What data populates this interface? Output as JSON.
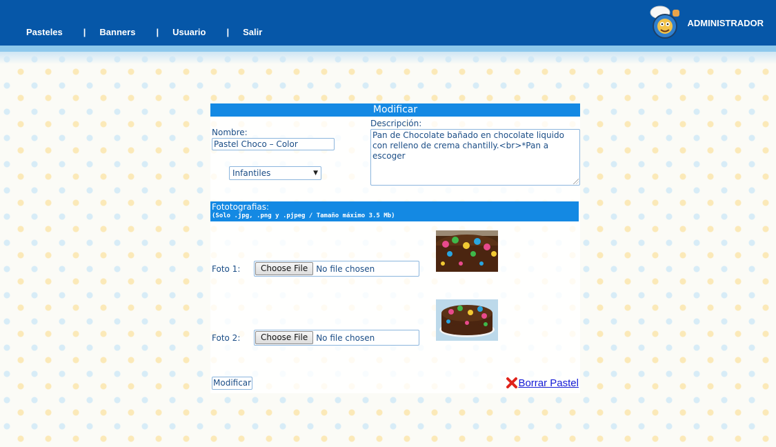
{
  "nav": {
    "items": [
      "Pasteles",
      "Banners",
      "Usuario",
      "Salir"
    ],
    "separator": "|"
  },
  "admin": {
    "label": "ADMINISTRADOR",
    "avatar_icon": "chef-mascot-icon"
  },
  "form": {
    "title": "Modificar",
    "name_label": "Nombre:",
    "name_value": "Pastel Choco – Color",
    "category_selected": "Infantiles",
    "description_label": "Descripción:",
    "description_value": "Pan de Chocolate bañado en chocolate liquido con relleno de crema chantilly.<br>*Pan a escoger",
    "photos_title": "Fototografias:",
    "photos_note": "(Solo .jpg, .png y .pjpeg / Tamaño máximo 3.5 Mb)",
    "photos": [
      {
        "label": "Foto 1:",
        "button": "Choose File",
        "status": "No file chosen"
      },
      {
        "label": "Foto 2:",
        "button": "Choose File",
        "status": "No file chosen"
      }
    ],
    "submit_label": "Modificar",
    "delete_label": "Borrar Pastel"
  },
  "colors": {
    "topbar": "#0657a8",
    "accent": "#1489e3",
    "delete_icon": "#e0241b",
    "link": "#1219d6"
  }
}
